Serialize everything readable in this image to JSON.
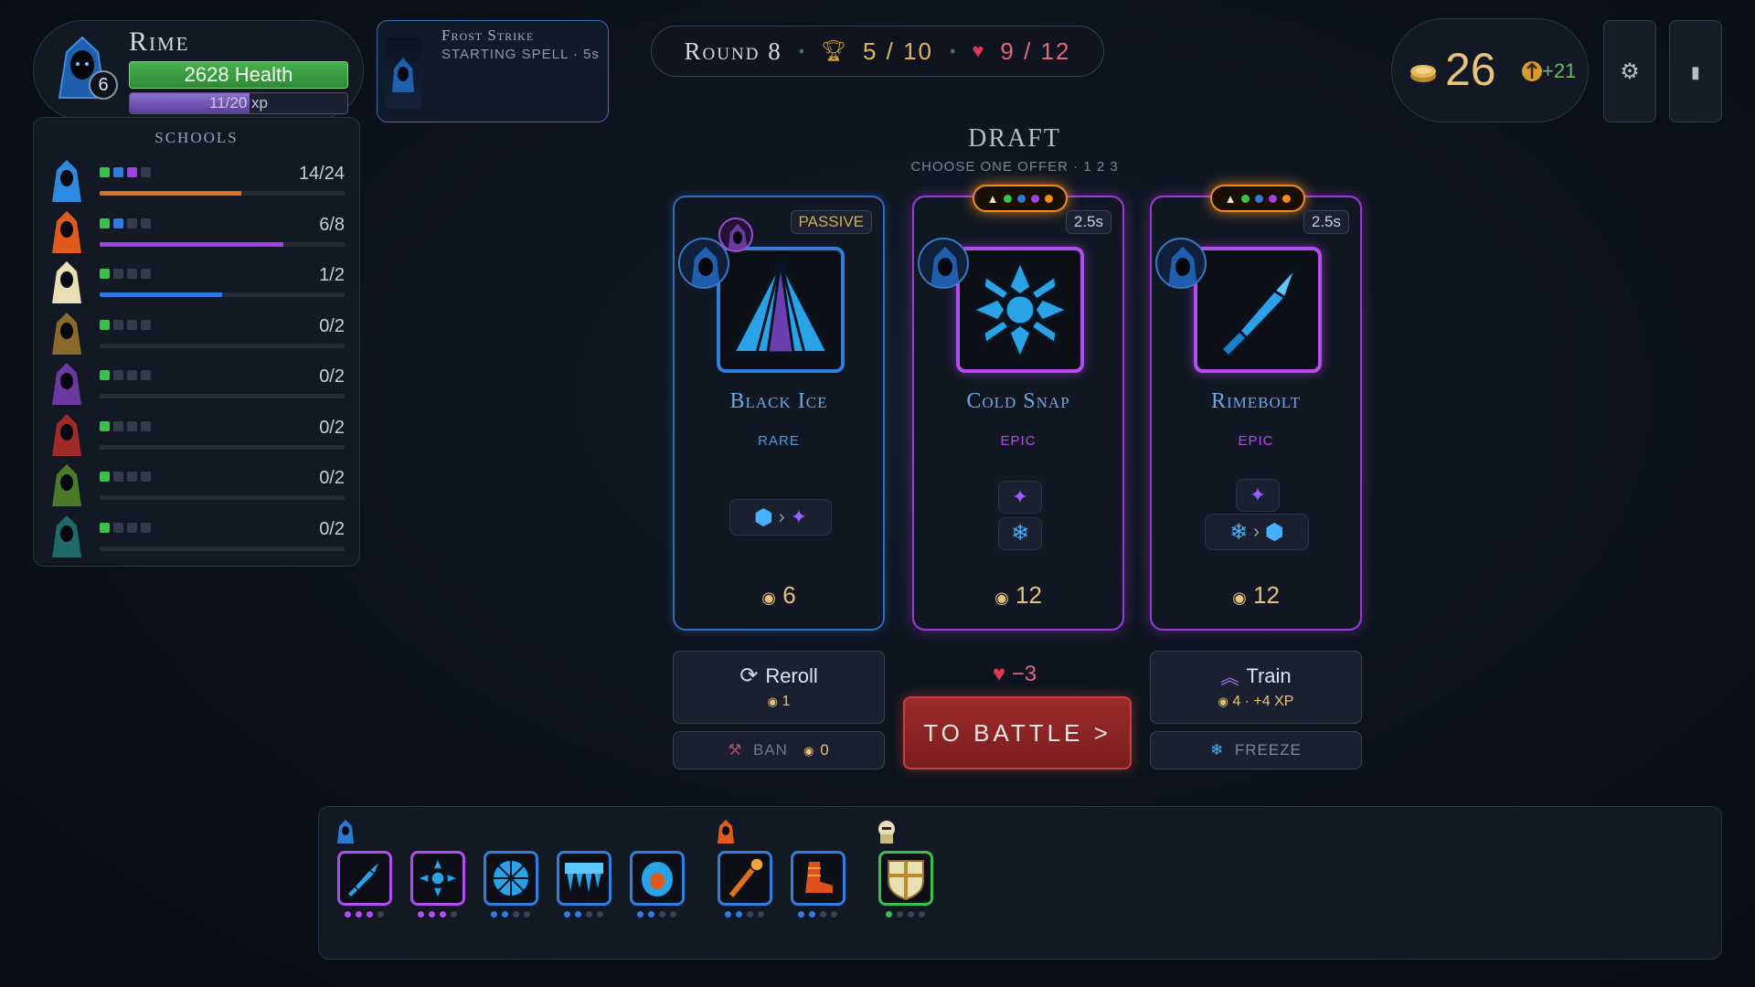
{
  "player": {
    "name": "Rime",
    "level": "6",
    "health_label": "2628 Health",
    "xp_label": "11/20 xp",
    "xp_progress": 0.55
  },
  "schools": {
    "title": "SCHOOLS",
    "rows": [
      {
        "count": "14/24",
        "color": "#2d8ae0",
        "bar_color": "#e0701e",
        "progress": 0.58,
        "pips": [
          "#39c24a",
          "#2d7be0",
          "#a040e8",
          "#343b4c"
        ]
      },
      {
        "count": "6/8",
        "color": "#e05a1e",
        "bar_color": "#a040e8",
        "progress": 0.75,
        "pips": [
          "#39c24a",
          "#2d7be0",
          "#343b4c",
          "#343b4c"
        ]
      },
      {
        "count": "1/2",
        "color": "#e8dfb5",
        "bar_color": "#2d7be0",
        "progress": 0.5,
        "pips": [
          "#39c24a",
          "#343b4c",
          "#343b4c",
          "#343b4c"
        ]
      },
      {
        "count": "0/2",
        "color": "#8a6a2a",
        "bar_color": "#2d7be0",
        "progress": 0,
        "pips": [
          "#39c24a",
          "#343b4c",
          "#343b4c",
          "#343b4c"
        ]
      },
      {
        "count": "0/2",
        "color": "#6a3aa0",
        "bar_color": "#2d7be0",
        "progress": 0,
        "pips": [
          "#39c24a",
          "#343b4c",
          "#343b4c",
          "#343b4c"
        ]
      },
      {
        "count": "0/2",
        "color": "#a02a2a",
        "bar_color": "#2d7be0",
        "progress": 0,
        "pips": [
          "#39c24a",
          "#343b4c",
          "#343b4c",
          "#343b4c"
        ]
      },
      {
        "count": "0/2",
        "color": "#4a7a2a",
        "bar_color": "#2d7be0",
        "progress": 0,
        "pips": [
          "#39c24a",
          "#343b4c",
          "#343b4c",
          "#343b4c"
        ]
      },
      {
        "count": "0/2",
        "color": "#1e6a6a",
        "bar_color": "#2d7be0",
        "progress": 0,
        "pips": [
          "#39c24a",
          "#343b4c",
          "#343b4c",
          "#343b4c"
        ]
      }
    ]
  },
  "starting_spell": {
    "name": "Frost Strike",
    "subtitle": "STARTING SPELL · 5s"
  },
  "round": {
    "label": "Round 8",
    "wins": "5 / 10",
    "lives": "9 / 12"
  },
  "gold": {
    "amount": "26",
    "income": "+21"
  },
  "draft": {
    "title": "DRAFT",
    "subtitle": "CHOOSE ONE OFFER · 1 2 3",
    "cards": [
      {
        "name": "Black Ice",
        "rarity": "RARE",
        "tag": "PASSIVE",
        "cost": "6",
        "rarity_color": "#4a9be6"
      },
      {
        "name": "Cold Snap",
        "rarity": "EPIC",
        "tag": "2.5s",
        "cost": "12",
        "rarity_color": "#b04ee8"
      },
      {
        "name": "Rimebolt",
        "rarity": "EPIC",
        "tag": "2.5s",
        "cost": "12",
        "rarity_color": "#b04ee8"
      }
    ]
  },
  "actions": {
    "reroll_label": "Reroll",
    "reroll_cost": "1",
    "ban_label": "BAN",
    "ban_cost": "0",
    "battle_cost": "−3",
    "battle_label": "TO BATTLE >",
    "train_label": "Train",
    "train_cost": "4 · +4 XP",
    "freeze_label": "FREEZE"
  },
  "colors": {
    "accent_gold": "#e6c37a",
    "health_green": "#3c9c44",
    "rare_blue": "#2f7fe0",
    "epic_purple": "#b44df0",
    "battle_red": "#8c2424"
  }
}
